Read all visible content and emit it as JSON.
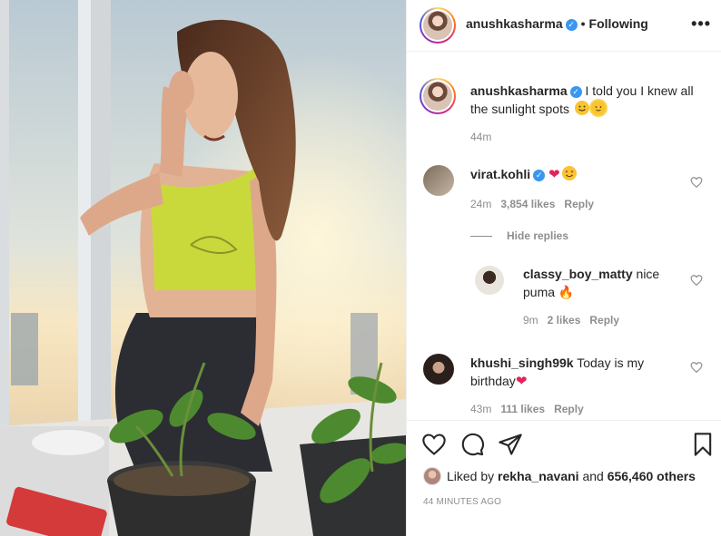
{
  "post_image": {
    "description_icon": "photo-icon",
    "colors": {
      "sky": "#c9d6dd",
      "sunset": "#f5e2b8",
      "top": "#c7d63a",
      "leggings": "#2b2d33",
      "hair": "#6a3f2a",
      "plant": "#4d8a2f"
    }
  },
  "header": {
    "username": "anushkasharma",
    "separator": "•",
    "follow_status": "Following",
    "more_icon": "more-options-icon",
    "more_label": "•••"
  },
  "caption": {
    "username": "anushkasharma",
    "text": "I told you I knew all the sunlight spots",
    "emojis": [
      "smiling-face-emoji",
      "sun-emoji"
    ],
    "time": "44m"
  },
  "comments": [
    {
      "username": "virat.kohli",
      "verified": true,
      "text": "",
      "emojis": [
        "red-heart-emoji",
        "heart-eyes-emoji"
      ],
      "time": "24m",
      "likes": "3,854 likes",
      "reply": "Reply"
    },
    {
      "username": "classy_boy_matty",
      "text": "nice puma",
      "emojis": [
        "fire-emoji"
      ],
      "time": "9m",
      "likes": "2 likes",
      "reply": "Reply"
    },
    {
      "username": "khushi_singh99k",
      "text": "Today is my birthday",
      "emojis": [
        "red-heart-emoji"
      ],
      "time": "43m",
      "likes": "111 likes",
      "reply": "Reply"
    }
  ],
  "hide_replies": "Hide replies",
  "actions": {
    "like_icon": "heart-icon",
    "comment_icon": "comment-icon",
    "share_icon": "share-icon",
    "save_icon": "bookmark-icon"
  },
  "liked_by": {
    "prefix": "Liked by",
    "user": "rekha_navani",
    "joiner": "and",
    "others": "656,460 others"
  },
  "post_time": "44 MINUTES AGO"
}
